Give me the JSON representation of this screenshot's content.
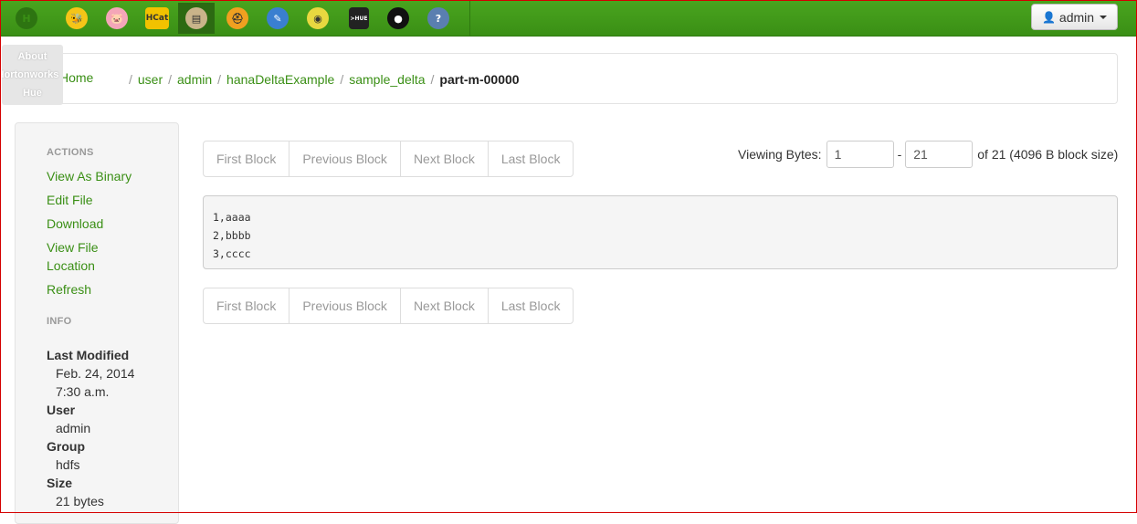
{
  "topbar": {
    "apps": [
      {
        "icon": "hue-logo-icon",
        "glyph": "H",
        "color": "#3a8f15",
        "bg": "#2d7411",
        "active": false
      },
      {
        "icon": "hive-bee-icon",
        "glyph": "🐝",
        "color": "#333",
        "bg": "#f5c518",
        "active": false
      },
      {
        "icon": "pig-icon",
        "glyph": "🐷",
        "color": "#333",
        "bg": "#f4a6b8",
        "active": false
      },
      {
        "icon": "hcat-icon",
        "glyph": "HCat",
        "color": "#333",
        "bg": "#f2c200",
        "active": false
      },
      {
        "icon": "file-browser-icon",
        "glyph": "▤",
        "color": "#333",
        "bg": "#c9b48a",
        "active": true
      },
      {
        "icon": "job-designer-hardhat-icon",
        "glyph": "⛑",
        "color": "#333",
        "bg": "#f0a020",
        "active": false
      },
      {
        "icon": "oozie-editor-icon",
        "glyph": "✎",
        "color": "#fff",
        "bg": "#3a7fd0",
        "active": false
      },
      {
        "icon": "job-browser-icon",
        "glyph": "◉",
        "color": "#333",
        "bg": "#e8d840",
        "active": false
      },
      {
        "icon": "shell-icon",
        "glyph": ">HUE",
        "color": "#fff",
        "bg": "#222",
        "active": false
      },
      {
        "icon": "user-admin-icon",
        "glyph": "●",
        "color": "#fff",
        "bg": "#111",
        "active": false
      },
      {
        "icon": "help-icon",
        "glyph": "?",
        "color": "#fff",
        "bg": "#5a7fb0",
        "active": false
      }
    ],
    "user_label": "admin"
  },
  "tooltip": {
    "lines": [
      "About",
      "Hortonworks",
      "Hue"
    ]
  },
  "breadcrumb": {
    "home": "Home",
    "segments": [
      "user",
      "admin",
      "hanaDeltaExample",
      "sample_delta"
    ],
    "current": "part-m-00000"
  },
  "sidebar": {
    "actions_header": "ACTIONS",
    "actions": [
      "View As Binary",
      "Edit File",
      "Download",
      "View File Location",
      "Refresh"
    ],
    "info_header": "INFO",
    "info": [
      {
        "label": "Last Modified",
        "values": [
          "Feb. 24, 2014",
          "7:30 a.m."
        ]
      },
      {
        "label": "User",
        "values": [
          "admin"
        ]
      },
      {
        "label": "Group",
        "values": [
          "hdfs"
        ]
      },
      {
        "label": "Size",
        "values": [
          "21 bytes"
        ]
      }
    ]
  },
  "pager": {
    "buttons": [
      "First Block",
      "Previous Block",
      "Next Block",
      "Last Block"
    ]
  },
  "viewing": {
    "label": "Viewing Bytes:",
    "from": "1",
    "dash": "-",
    "to": "21",
    "suffix": "of 21 (4096 B block size)"
  },
  "file": {
    "lines": [
      "1,aaaa",
      "2,bbbb",
      "3,cccc"
    ]
  }
}
